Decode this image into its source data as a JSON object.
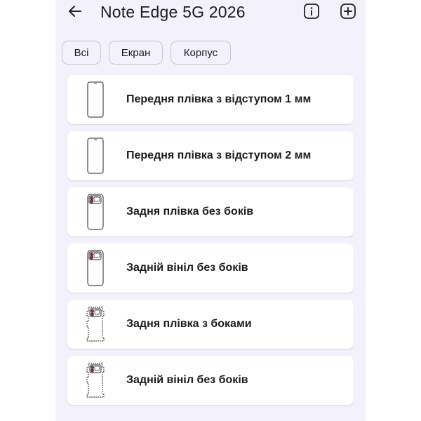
{
  "header": {
    "title": "Note Edge 5G 2026",
    "back_icon": "arrow-left-icon",
    "info_icon": "info-icon",
    "add_icon": "plus-circle-icon"
  },
  "filters": {
    "chips": [
      {
        "label": "Всі"
      },
      {
        "label": "Екран"
      },
      {
        "label": "Корпус"
      }
    ]
  },
  "templates": {
    "items": [
      {
        "label": "Передня плівка з відступом 1 мм",
        "icon": "phone-front-outline-icon"
      },
      {
        "label": "Передня плівка з відступом 2 мм",
        "icon": "phone-front-outline-icon"
      },
      {
        "label": "Задня плівка без боків",
        "icon": "phone-back-camera-icon"
      },
      {
        "label": "Задній вініл без боків",
        "icon": "phone-back-camera-icon"
      },
      {
        "label": "Задня плівка з боками",
        "icon": "phone-back-wrap-icon"
      },
      {
        "label": "Задній вініл без боків",
        "icon": "phone-back-wrap-icon"
      }
    ]
  },
  "colors": {
    "background": "#f3f1fb",
    "card": "#ffffff",
    "camera_accent": "#8a2f42",
    "text": "#1d1b20"
  }
}
